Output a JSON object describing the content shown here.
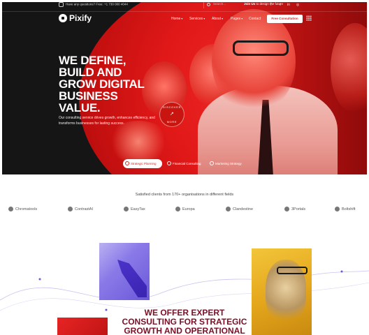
{
  "topbar": {
    "phone_text": "Have any questions? Free: +1 730 000 4044",
    "search_placeholder": "Search...",
    "join_prefix": "Join Us",
    "join_text": "to design the future",
    "social": [
      "f",
      "t",
      "in",
      "◎"
    ]
  },
  "nav": {
    "brand": "Pixify",
    "items": [
      {
        "label": "Home",
        "caret": "▾"
      },
      {
        "label": "Services",
        "caret": "▾"
      },
      {
        "label": "About",
        "caret": "▾"
      },
      {
        "label": "Pages",
        "caret": "▾"
      },
      {
        "label": "Contact",
        "caret": ""
      }
    ],
    "cta": "Free Consultation"
  },
  "hero": {
    "headline_lines": [
      "WE DEFINE,",
      "BUILD AND",
      "GROW DIGITAL",
      "BUSINESS",
      "VALUE."
    ],
    "description": "Our consulting service drives growth, enhances efficiency, and transforms businesses for lasting success.",
    "discover_top": "DISCOVER",
    "discover_bottom": "MORE",
    "discover_arrow": "↗",
    "tabs": [
      {
        "label": "Strategic Planning",
        "active": true
      },
      {
        "label": "Financial Consulting",
        "active": false
      },
      {
        "label": "Marketing Strategy",
        "active": false
      }
    ],
    "accent_color": "#e31c1c"
  },
  "clients": {
    "title": "Satisfied clients from 170+ organisations in different fields",
    "logos": [
      "Chromatools",
      "ContrastAI",
      "EasyTax",
      "Europa",
      "Clandestine",
      "3Portals",
      "Boltshift"
    ]
  },
  "section": {
    "heading_lines": [
      "WE OFFER EXPERT",
      "CONSULTING FOR STRATEGIC",
      "GROWTH AND OPERATIONAL"
    ],
    "heading_color": "#7a0f26"
  }
}
